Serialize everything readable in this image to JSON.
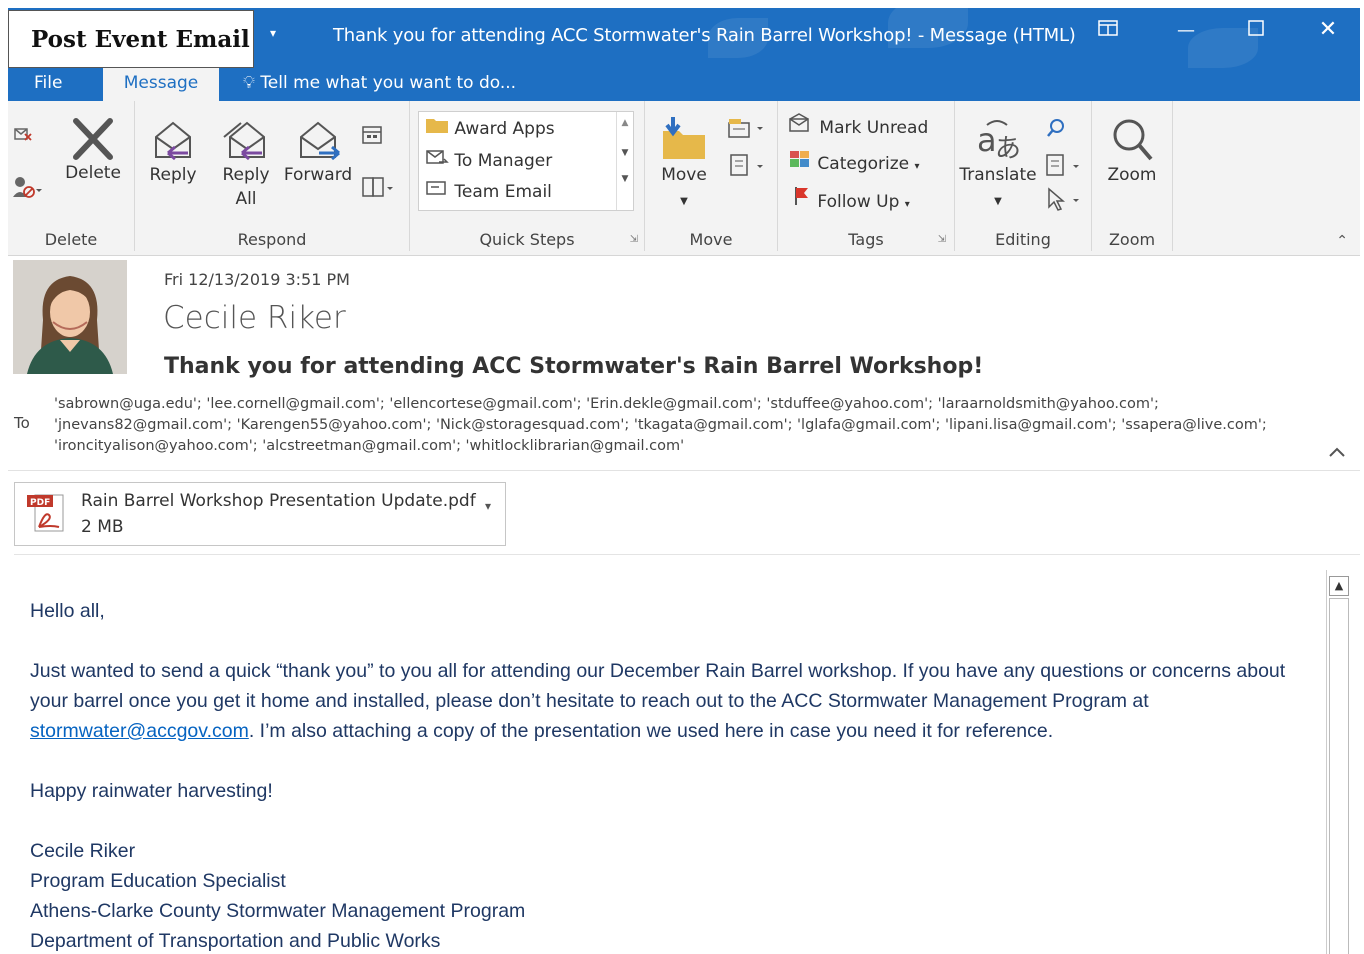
{
  "caption": "Post Event Email",
  "window": {
    "title": "Thank you for attending ACC Stormwater's Rain Barrel Workshop!  -  Message (HTML)",
    "qat_icon": "dropdown-icon",
    "controls": [
      "restore-ribbon-icon",
      "minimize-icon",
      "maximize-icon",
      "close-icon"
    ]
  },
  "tabs": {
    "file": "File",
    "message": "Message",
    "tellme": "Tell me what you want to do..."
  },
  "ribbon": {
    "delete_group": {
      "label": "Delete",
      "delete": "Delete"
    },
    "respond_group": {
      "label": "Respond",
      "reply": "Reply",
      "reply_all_1": "Reply",
      "reply_all_2": "All",
      "forward": "Forward"
    },
    "quicksteps_group": {
      "label": "Quick Steps",
      "items": [
        "Award Apps",
        "To Manager",
        "Team Email"
      ]
    },
    "move_group": {
      "label": "Move",
      "move": "Move"
    },
    "tags_group": {
      "label": "Tags",
      "mark_unread": "Mark Unread",
      "categorize": "Categorize",
      "follow_up": "Follow Up"
    },
    "editing_group": {
      "label": "Editing",
      "translate": "Translate"
    },
    "zoom_group": {
      "label": "Zoom",
      "zoom": "Zoom"
    }
  },
  "message": {
    "date": "Fri 12/13/2019 3:51 PM",
    "sender": "Cecile Riker",
    "subject": "Thank you for attending ACC Stormwater's Rain Barrel Workshop!",
    "to_label": "To",
    "recipients_line1": "'sabrown@uga.edu'; 'lee.cornell@gmail.com'; 'ellencortese@gmail.com'; 'Erin.dekle@gmail.com'; 'stduffee@yahoo.com'; 'laraarnoldsmith@yahoo.com';",
    "recipients_line2": "'jnevans82@gmail.com'; 'Karengen55@yahoo.com'; 'Nick@storagesquad.com'; 'tkagata@gmail.com'; 'lglafa@gmail.com'; 'lipani.lisa@gmail.com'; 'ssapera@live.com';",
    "recipients_line3": "'ironcityalison@yahoo.com'; 'alcstreetman@gmail.com'; 'whitlocklibrarian@gmail.com'"
  },
  "attachment": {
    "name": "Rain Barrel Workshop Presentation Update.pdf",
    "size": "2 MB",
    "badge": "PDF"
  },
  "body": {
    "greeting": "Hello all,",
    "para1_a": "Just wanted to send a quick “thank you” to you all for attending our December Rain Barrel workshop. If you have any questions or concerns about your barrel once you get it home and installed, please don’t hesitate to reach out to the ACC Stormwater Management Program at ",
    "para1_link": "stormwater@accgov.com",
    "para1_b": ". I’m also attaching a copy of the presentation we used here in case you need it for reference.",
    "closing": "Happy rainwater harvesting!",
    "sig_name": "Cecile Riker",
    "sig_title": "Program Education Specialist",
    "sig_org": "Athens-Clarke County Stormwater Management Program",
    "sig_dept": "Department of Transportation and Public Works"
  },
  "colors": {
    "titlebar": "#1e6fc2",
    "body_text": "#1f3864",
    "link": "#0563c1",
    "reply_arrow": "#7b4aa0",
    "forward_arrow": "#2f6fc0"
  }
}
